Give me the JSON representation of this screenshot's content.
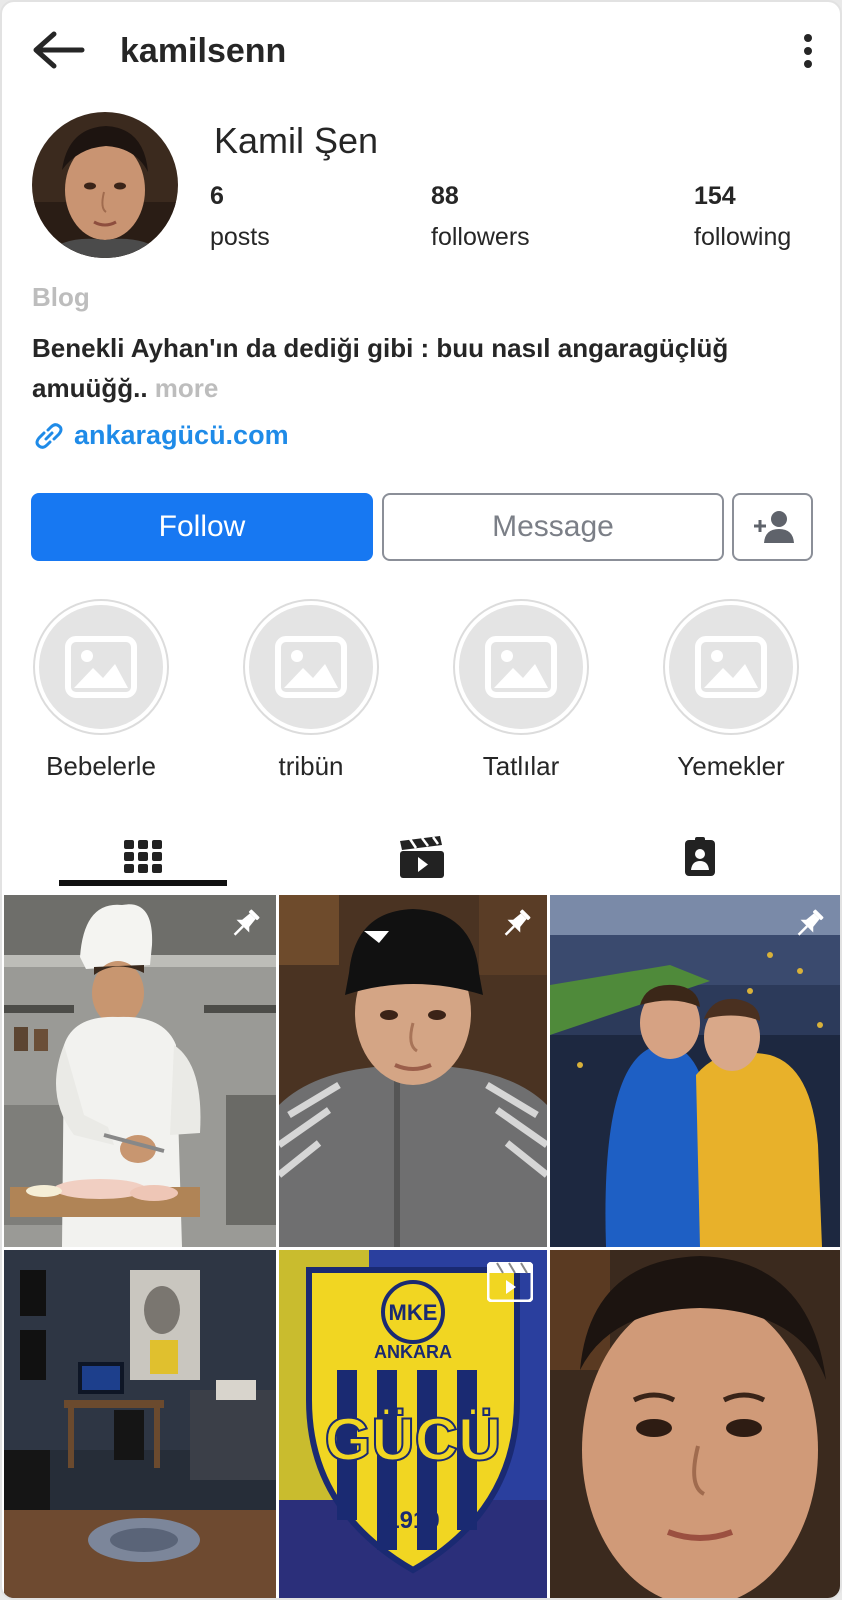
{
  "header": {
    "username": "kamilsenn",
    "back_icon": "arrow-left-icon",
    "menu_icon": "more-vertical-icon"
  },
  "profile": {
    "full_name": "Kamil Şen",
    "stats": [
      {
        "value": "6",
        "label": "posts"
      },
      {
        "value": "88",
        "label": "followers"
      },
      {
        "value": "154",
        "label": "following"
      }
    ],
    "category": "Blog",
    "bio": "Benekli Ayhan'ın da dediği gibi : buu nasıl angaragüçlüğ amuüğğ..",
    "more": "more",
    "link": "ankaragücü.com"
  },
  "actions": {
    "follow_label": "Follow",
    "message_label": "Message",
    "add_user_icon": "add-user-icon"
  },
  "highlights": [
    {
      "label": "Bebelerle"
    },
    {
      "label": "tribün"
    },
    {
      "label": "Tatlılar"
    },
    {
      "label": "Yemekler"
    }
  ],
  "tabs": [
    {
      "icon": "grid-icon",
      "active": true
    },
    {
      "icon": "reels-icon",
      "active": false
    },
    {
      "icon": "tagged-icon",
      "active": false
    }
  ],
  "colors": {
    "primary": "#1778f2",
    "link": "#1f8be8",
    "muted": "#bdbdbd"
  },
  "posts": [
    {
      "kind": "photo",
      "pinned": true,
      "subject": "chef cutting chicken in kitchen"
    },
    {
      "kind": "photo",
      "pinned": true,
      "subject": "young man in black cap"
    },
    {
      "kind": "photo",
      "pinned": true,
      "subject": "two friends in stadium"
    },
    {
      "kind": "photo",
      "pinned": false,
      "subject": "dark bedroom with desk"
    },
    {
      "kind": "reel",
      "pinned": false,
      "subject": "Ankaragücü club crest"
    },
    {
      "kind": "photo",
      "pinned": false,
      "subject": "close-up portrait"
    }
  ],
  "post6_crest_text": {
    "top": "MKE",
    "middle": "ANKARA",
    "main": "GÜCÜ",
    "year": "1910"
  }
}
